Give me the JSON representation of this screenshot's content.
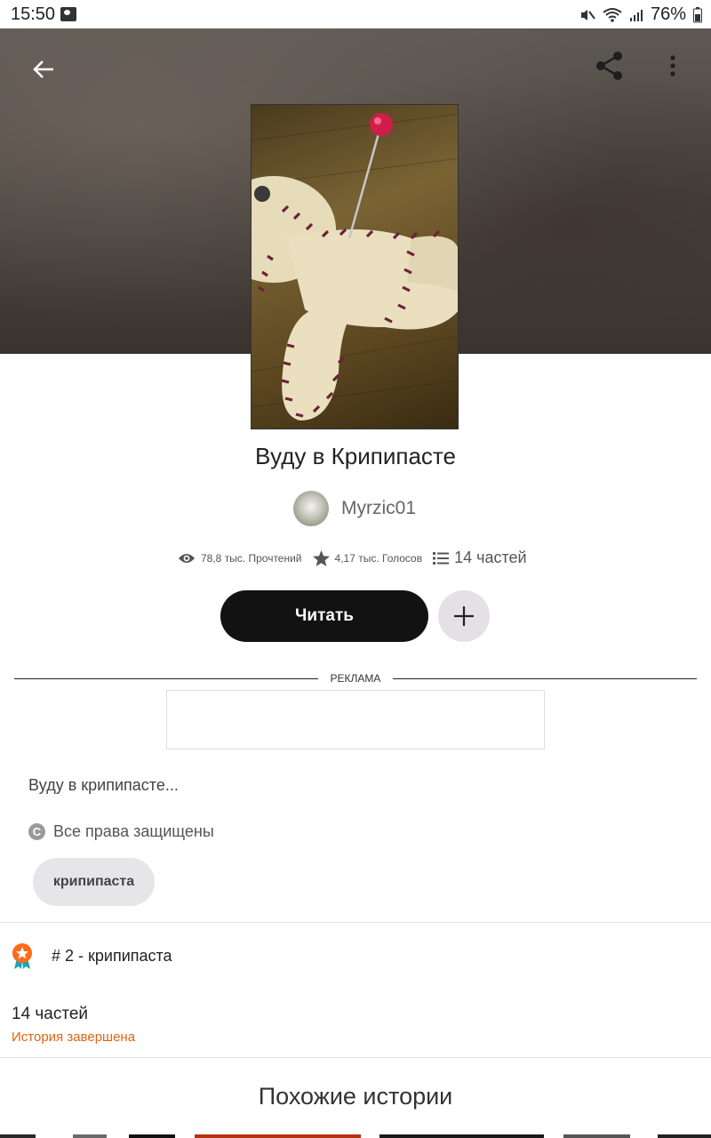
{
  "status_bar": {
    "time": "15:50",
    "battery": "76%"
  },
  "story": {
    "title": "Вуду в Крипипасте",
    "author": "Myrzic01",
    "reads": "78,8 тыс. Прочтений",
    "votes": "4,17 тыс. Голосов",
    "parts": "14 частей",
    "read_button": "Читать",
    "ad_label": "РЕКЛАМА",
    "description": "Вуду в крипипасте...",
    "copyright": "Все права защищены",
    "tag": "крипипаста",
    "rank": "# 2 - крипипаста",
    "parts_count": "14 частей",
    "completion_status": "История завершена"
  },
  "similar_title": "Похожие истории",
  "colors": {
    "accent_orange": "#e06512",
    "read_button": "#121212",
    "add_button": "#e3e1e4"
  },
  "icons": [
    "back-arrow-icon",
    "share-icon",
    "more-vert-icon",
    "eye-icon",
    "star-icon",
    "list-icon",
    "plus-icon",
    "copyright-icon",
    "rank-badge-icon"
  ]
}
